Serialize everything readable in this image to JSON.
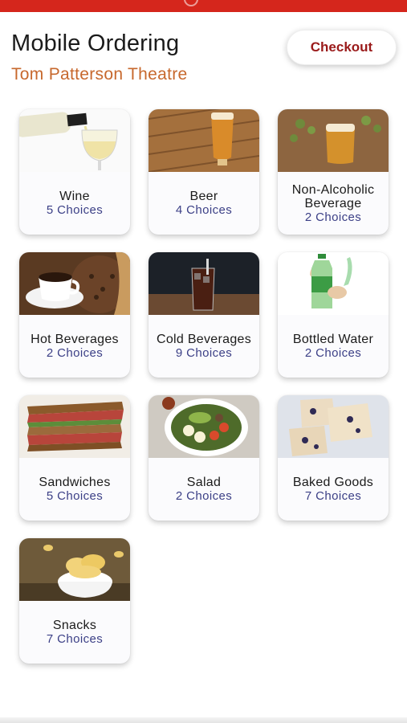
{
  "header": {
    "title": "Mobile Ordering",
    "venue": "Tom Patterson Theatre",
    "checkout_label": "Checkout"
  },
  "categories": [
    {
      "name": "Wine",
      "choices": "5 Choices",
      "icon": "wine-image"
    },
    {
      "name": "Beer",
      "choices": "4 Choices",
      "icon": "beer-image"
    },
    {
      "name": "Non-Alcoholic Beverage",
      "choices": "2 Choices",
      "icon": "non-alcoholic-beverage-image"
    },
    {
      "name": "Hot Beverages",
      "choices": "2 Choices",
      "icon": "coffee-image"
    },
    {
      "name": "Cold Beverages",
      "choices": "9 Choices",
      "icon": "cold-beverage-image"
    },
    {
      "name": "Bottled Water",
      "choices": "2 Choices",
      "icon": "bottled-water-image"
    },
    {
      "name": "Sandwiches",
      "choices": "5 Choices",
      "icon": "sandwich-image"
    },
    {
      "name": "Salad",
      "choices": "2 Choices",
      "icon": "salad-image"
    },
    {
      "name": "Baked Goods",
      "choices": "7 Choices",
      "icon": "baked-goods-image"
    },
    {
      "name": "Snacks",
      "choices": "7 Choices",
      "icon": "snacks-image"
    }
  ],
  "colors": {
    "top_bar": "#d5261c",
    "venue_text": "#c7682d",
    "checkout_text": "#9a1a1a",
    "choices_text": "#3b3f86"
  }
}
